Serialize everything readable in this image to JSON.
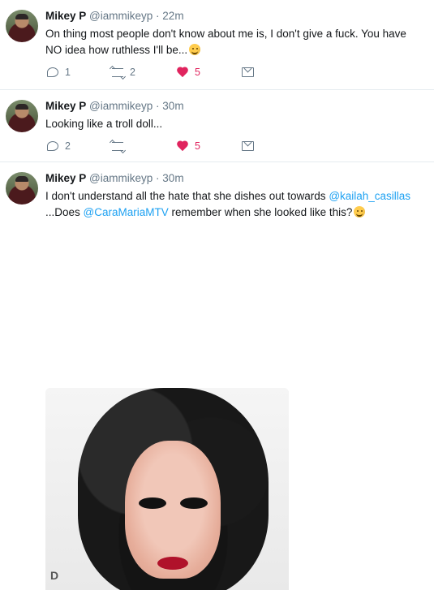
{
  "tweets": [
    {
      "name": "Mikey P",
      "handle": "@iammikeyp",
      "dot": "·",
      "time": "22m",
      "text_line1": "On thing most people don't know about me is, I don't give a fuck. You have",
      "text_line2": "NO idea how ruthless I'll be...",
      "replies": "1",
      "retweets": "2",
      "likes": "5"
    },
    {
      "name": "Mikey P",
      "handle": "@iammikeyp",
      "dot": "·",
      "time": "30m",
      "text_line1": "Looking like a troll doll...",
      "replies": "2",
      "retweets": "",
      "likes": "5"
    },
    {
      "name": "Mikey P",
      "handle": "@iammikeyp",
      "dot": "·",
      "time": "30m",
      "text_line1_pre": "I don't understand all the hate that she dishes out towards ",
      "text_line1_mention": "@kailah_casillas",
      "text_line2_pre": "...Does ",
      "text_line2_mention": "@CaraMariaMTV",
      "text_line2_post": " remember when she looked like this?"
    }
  ],
  "icons": {
    "reply": "reply-icon",
    "retweet": "retweet-icon",
    "like": "heart-icon",
    "message": "direct-message-icon"
  },
  "colors": {
    "accent": "#1da1f2",
    "like": "#e0245e",
    "muted": "#657786"
  }
}
